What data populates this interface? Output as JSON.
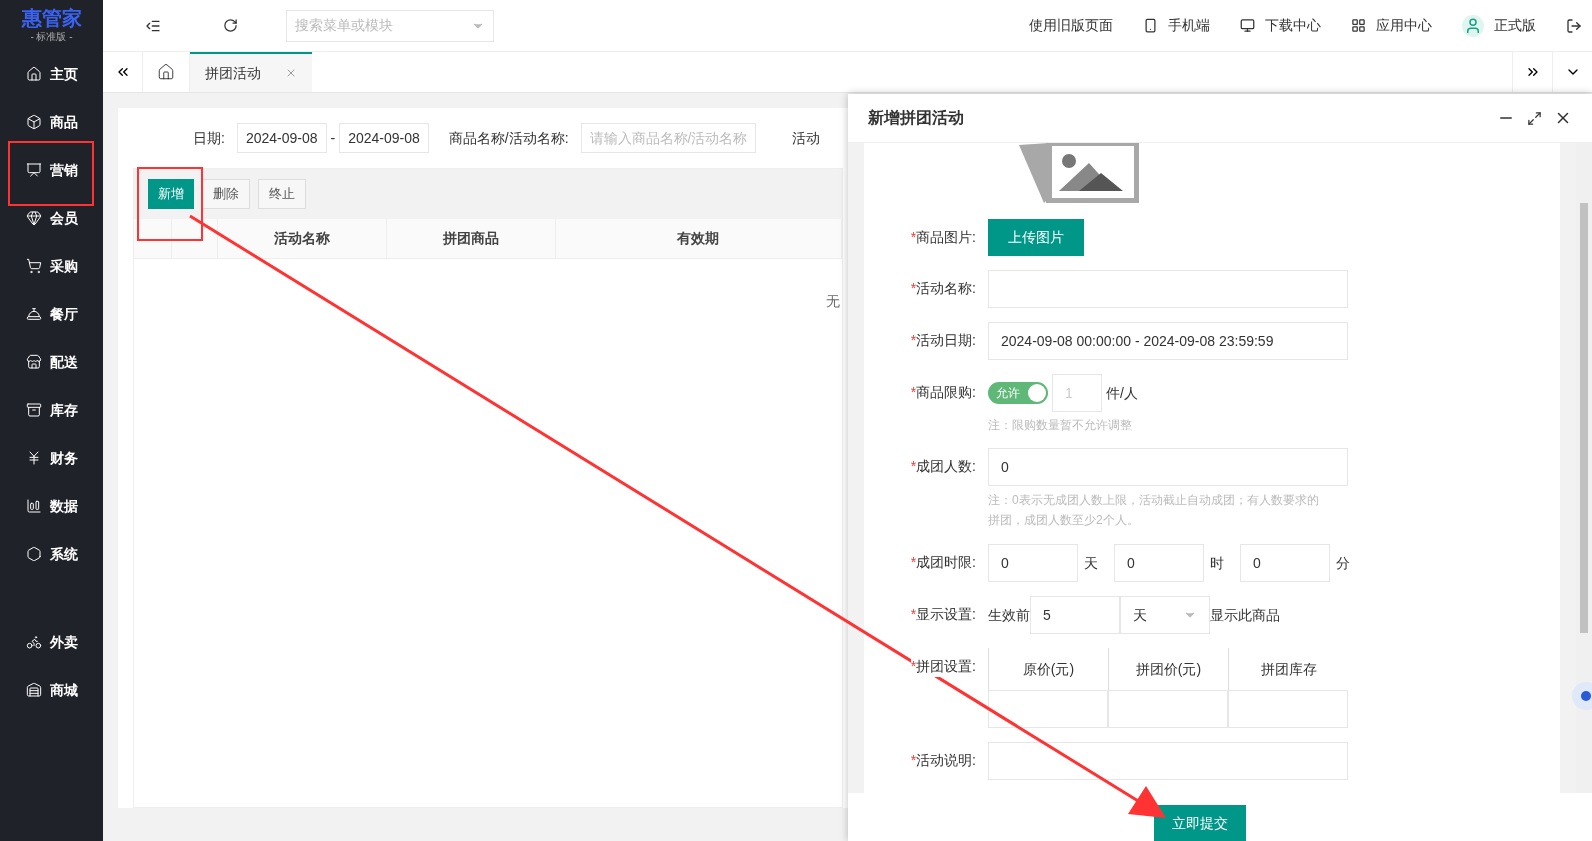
{
  "logo": {
    "name": "惠管家",
    "edition": "- 标准版 -"
  },
  "sidebar": {
    "items": [
      {
        "label": "主页"
      },
      {
        "label": "商品"
      },
      {
        "label": "营销"
      },
      {
        "label": "会员"
      },
      {
        "label": "采购"
      },
      {
        "label": "餐厅"
      },
      {
        "label": "配送"
      },
      {
        "label": "库存"
      },
      {
        "label": "财务"
      },
      {
        "label": "数据"
      },
      {
        "label": "系统"
      }
    ],
    "extra_items": [
      {
        "label": "外卖"
      },
      {
        "label": "商城"
      }
    ]
  },
  "topbar": {
    "search_placeholder": "搜索菜单或模块",
    "links": [
      {
        "label": "使用旧版页面"
      },
      {
        "label": "手机端"
      },
      {
        "label": "下载中心"
      },
      {
        "label": "应用中心"
      },
      {
        "label": "正式版"
      }
    ]
  },
  "tabs": [
    {
      "label": "拼团活动",
      "selected": true
    }
  ],
  "filters": {
    "date_label": "日期:",
    "date_from": "2024-09-08",
    "separator": "-",
    "date_to": "2024-09-08",
    "name_label": "商品名称/活动名称:",
    "name_placeholder": "请输入商品名称/活动名称",
    "status_label": "活动"
  },
  "toolbar": [
    {
      "label": "新增",
      "kind": "primary"
    },
    {
      "label": "删除",
      "kind": "default"
    },
    {
      "label": "终止",
      "kind": "default"
    }
  ],
  "table": {
    "columns": [
      "活动名称",
      "拼团商品",
      "有效期"
    ],
    "empty_text": "无"
  },
  "dialog": {
    "title": "新增拼团活动",
    "image_label": {
      "mark": "*",
      "text": "商品图片:"
    },
    "upload_button": "上传图片",
    "name_label": {
      "mark": "*",
      "text": "活动名称:"
    },
    "date_label": {
      "mark": "*",
      "text": "活动日期:"
    },
    "date_value": "2024-09-08 00:00:00 - 2024-09-08 23:59:59",
    "limit_label": {
      "mark": "*",
      "text": "商品限购:"
    },
    "limit_toggle": {
      "label": "允许",
      "on": true
    },
    "limit_value": "1",
    "limit_disabled": true,
    "limit_unit": "件/人",
    "limit_note": "注：限购数量暂不允许调整",
    "size_label": {
      "mark": "*",
      "text": "成团人数:"
    },
    "size_value": "0",
    "size_note": "注：0表示无成团人数上限，活动截止自动成团；有人数要求的拼团，成团人数至少2个人。",
    "time_label": {
      "mark": "*",
      "text": "成团时限:"
    },
    "time_fields": [
      {
        "value": "0",
        "unit": "天"
      },
      {
        "value": "0",
        "unit": "时"
      },
      {
        "value": "0",
        "unit": "分"
      }
    ],
    "display_label": {
      "mark": "*",
      "text": "显示设置:"
    },
    "display_prefix": "生效前",
    "display_value": "5",
    "display_unit": "天",
    "display_suffix": "显示此商品",
    "group_label": {
      "mark": "*",
      "text": "拼团设置:"
    },
    "group_columns": [
      "原价(元)",
      "拼团价(元)",
      "拼团库存"
    ],
    "desc_label": {
      "mark": "*",
      "text": "活动说明:"
    },
    "submit": "立即提交"
  }
}
